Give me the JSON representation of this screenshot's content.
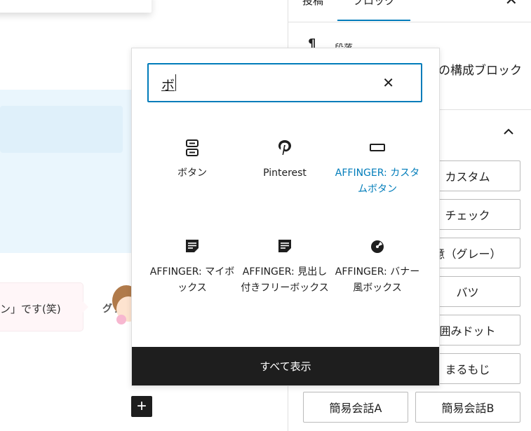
{
  "sidebar": {
    "tabs": [
      {
        "label": "投稿"
      },
      {
        "label": "ブロック"
      }
    ],
    "block_card_icon": "¶",
    "block_card_title": "段落",
    "block_card_desc": "の構成ブロック",
    "style_buttons": [
      "カスタム",
      "チェック",
      "意（グレー）",
      "バツ",
      "囲みドット",
      "まるもじ",
      "簡易会話A",
      "簡易会話B"
    ]
  },
  "editor": {
    "bubble_text": "ン」です(笑)",
    "avatar_kana": "グッ"
  },
  "inserter": {
    "search_value": "ボ",
    "show_all_label": "すべて表示",
    "items": [
      {
        "label": "ボタン",
        "icon": "buttons-icon"
      },
      {
        "label": "Pinterest",
        "icon": "pinterest-icon"
      },
      {
        "label": "AFFINGER: カスタムボタン",
        "icon": "custom-button-icon"
      },
      {
        "label": "AFFINGER: マイボックス",
        "icon": "my-box-icon"
      },
      {
        "label": "AFFINGER: 見出し付きフリーボックス",
        "icon": "heading-box-icon"
      },
      {
        "label": "AFFINGER: バナー風ボックス",
        "icon": "banner-box-icon"
      }
    ]
  },
  "colors": {
    "accent": "#007cba",
    "dark": "#1e1e1e"
  }
}
